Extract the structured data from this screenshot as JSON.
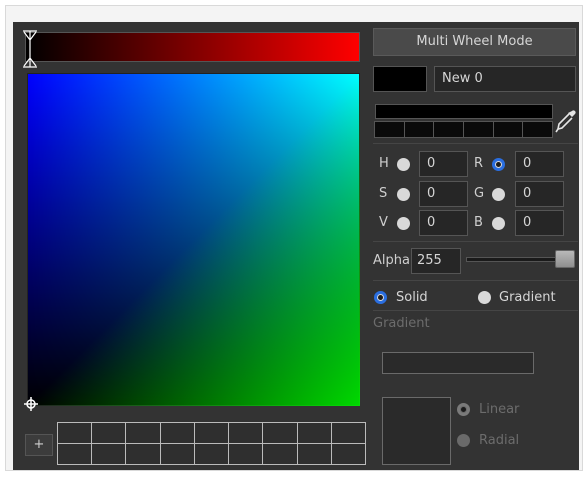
{
  "toolbar": {
    "multi_wheel_label": "Multi Wheel Mode",
    "add_swatch_label": "+"
  },
  "color": {
    "name": "New 0",
    "current_hex": "#000000"
  },
  "channels": {
    "H": {
      "label": "H",
      "value": "0"
    },
    "S": {
      "label": "S",
      "value": "0"
    },
    "V": {
      "label": "V",
      "value": "0"
    },
    "R": {
      "label": "R",
      "value": "0"
    },
    "G": {
      "label": "G",
      "value": "0"
    },
    "B": {
      "label": "B",
      "value": "0"
    },
    "selected_channel": "R"
  },
  "alpha": {
    "label": "Alpha",
    "value": "255",
    "fraction": 1.0
  },
  "fill_mode": {
    "solid_label": "Solid",
    "gradient_label": "Gradient",
    "selected": "Solid"
  },
  "gradient": {
    "section_label": "Gradient",
    "linear_label": "Linear",
    "radial_label": "Radial",
    "selected": "Linear"
  },
  "icons": {
    "eyedropper": "eyedropper-icon",
    "hue_marker": "hue-marker-icon",
    "sv_cursor": "crosshair-icon"
  },
  "colors": {
    "panel_bg": "#333333",
    "accent": "#2a6ee0",
    "hue_start": "#000000",
    "hue_end": "#ff0000"
  }
}
